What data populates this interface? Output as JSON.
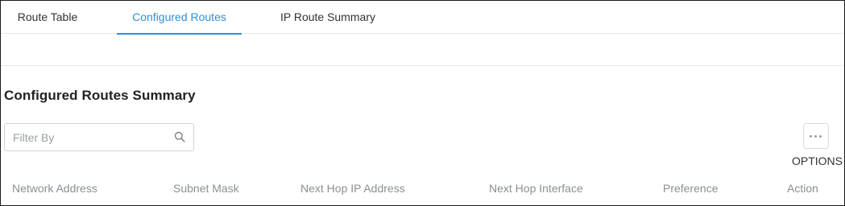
{
  "tabs": [
    {
      "label": "Route Table",
      "active": false
    },
    {
      "label": "Configured Routes",
      "active": true
    },
    {
      "label": "IP Route Summary",
      "active": false
    }
  ],
  "section": {
    "title": "Configured Routes Summary"
  },
  "filter": {
    "placeholder": "Filter By",
    "value": ""
  },
  "options": {
    "label": "OPTIONS",
    "icon": "more-horizontal-icon"
  },
  "table": {
    "columns": [
      "Network Address",
      "Subnet Mask",
      "Next Hop IP Address",
      "Next Hop Interface",
      "Preference",
      "Action"
    ]
  },
  "colors": {
    "accent": "#2f8fd8",
    "muted_text": "#8a8f94",
    "border": "#e6e6e6"
  }
}
